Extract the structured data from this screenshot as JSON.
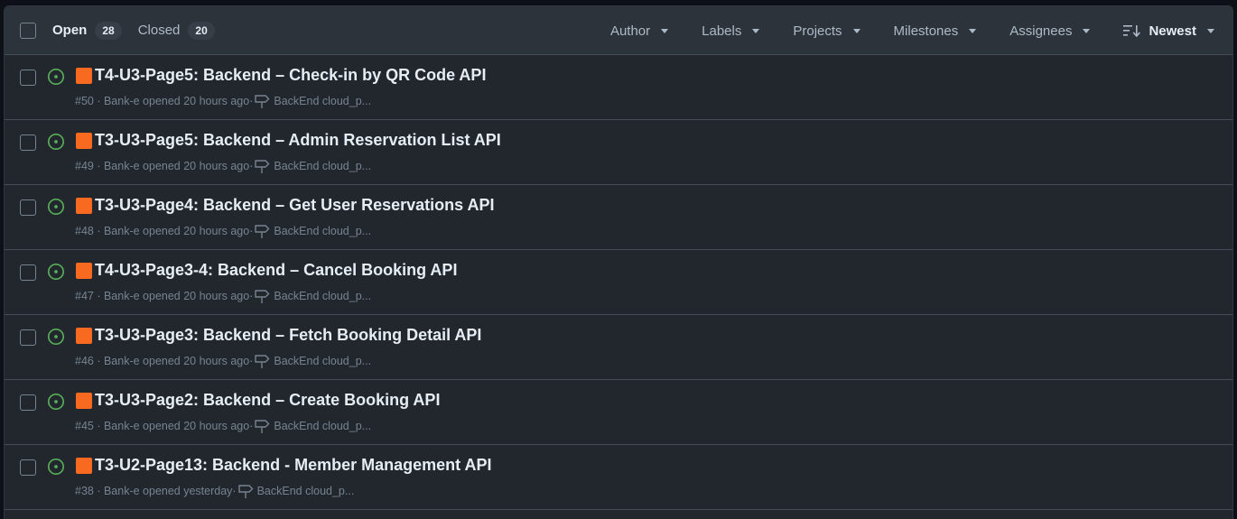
{
  "header": {
    "open_label": "Open",
    "open_count": "28",
    "closed_label": "Closed",
    "closed_count": "20",
    "filters": {
      "author": "Author",
      "labels": "Labels",
      "projects": "Projects",
      "milestones": "Milestones",
      "assignees": "Assignees",
      "sort": "Newest"
    }
  },
  "colors": {
    "open_icon": "#57ab5a",
    "label_square": "#f76a20"
  },
  "issues": [
    {
      "title": "T4-U3-Page5: Backend – Check-in by QR Code API",
      "meta": "#50 · Bank-e opened 20 hours ago·",
      "milestone": "BackEnd cloud_p..."
    },
    {
      "title": "T3-U3-Page5: Backend – Admin Reservation List API",
      "meta": "#49 · Bank-e opened 20 hours ago·",
      "milestone": "BackEnd cloud_p..."
    },
    {
      "title": "T3-U3-Page4: Backend – Get User Reservations API",
      "meta": "#48 · Bank-e opened 20 hours ago·",
      "milestone": "BackEnd cloud_p..."
    },
    {
      "title": "T4-U3-Page3-4: Backend – Cancel Booking API",
      "meta": "#47 · Bank-e opened 20 hours ago·",
      "milestone": "BackEnd cloud_p..."
    },
    {
      "title": "T3-U3-Page3: Backend – Fetch Booking Detail API",
      "meta": "#46 · Bank-e opened 20 hours ago·",
      "milestone": "BackEnd cloud_p..."
    },
    {
      "title": "T3-U3-Page2: Backend – Create Booking API",
      "meta": "#45 · Bank-e opened 20 hours ago·",
      "milestone": "BackEnd cloud_p..."
    },
    {
      "title": "T3-U2-Page13: Backend - Member Management API",
      "meta": "#38 · Bank-e opened yesterday·",
      "milestone": "BackEnd cloud_p..."
    }
  ]
}
